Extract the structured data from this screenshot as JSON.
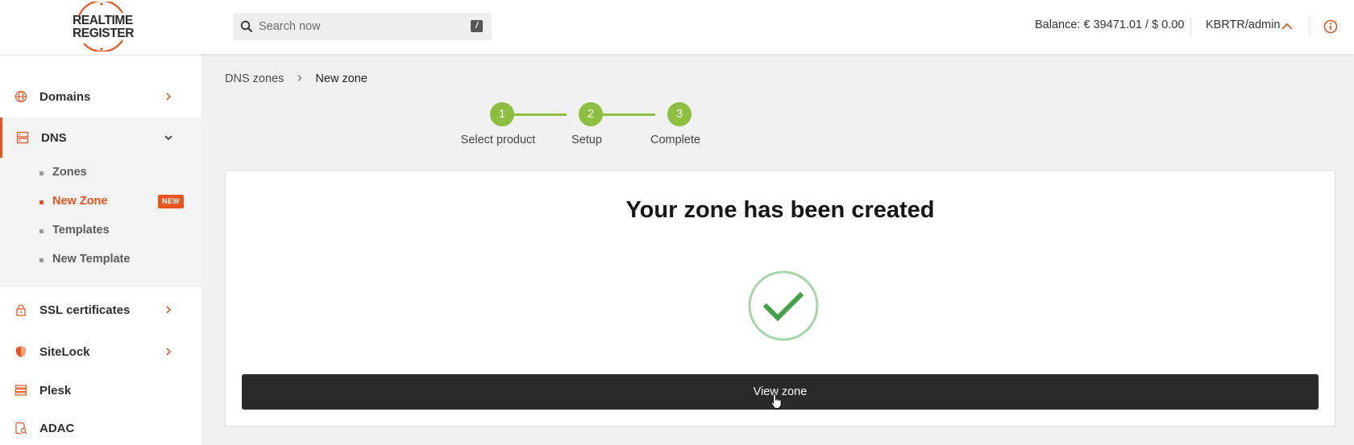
{
  "header": {
    "logo_line1": "REALTIME",
    "logo_line2": "REGISTER",
    "search_placeholder": "Search now",
    "search_shortcut": "/",
    "balance": "Balance: € 39471.01 / $ 0.00",
    "account": "KBRTR/admin"
  },
  "sidebar": {
    "items": [
      {
        "label": "Domains",
        "icon": "globe-icon"
      },
      {
        "label": "DNS",
        "icon": "server-icon"
      },
      {
        "label": "SSL certificates",
        "icon": "lock-icon"
      },
      {
        "label": "SiteLock",
        "icon": "shield-icon"
      },
      {
        "label": "Plesk",
        "icon": "stack-icon"
      },
      {
        "label": "ADAC",
        "icon": "document-search-icon"
      }
    ],
    "dns_submenu": [
      {
        "label": "Zones"
      },
      {
        "label": "New Zone",
        "badge": "NEW"
      },
      {
        "label": "Templates"
      },
      {
        "label": "New Template"
      }
    ]
  },
  "breadcrumb": {
    "parent": "DNS zones",
    "current": "New zone"
  },
  "stepper": {
    "steps": [
      {
        "number": "1",
        "label": "Select product"
      },
      {
        "number": "2",
        "label": "Setup"
      },
      {
        "number": "3",
        "label": "Complete"
      }
    ]
  },
  "main": {
    "title": "Your zone has been created",
    "button_label": "View zone"
  },
  "colors": {
    "accent": "#e8551e",
    "step_green": "#8cbf3f",
    "success_green": "#43a047",
    "success_ring": "#a5d6a7",
    "button_dark": "#2a2a2a"
  }
}
